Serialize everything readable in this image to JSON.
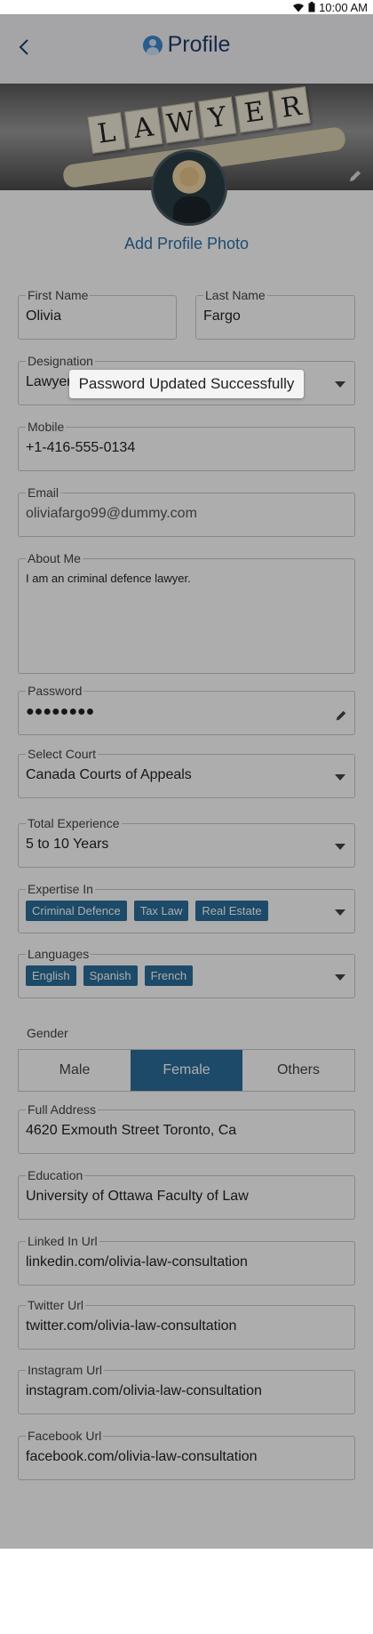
{
  "status": {
    "time": "10:00 AM"
  },
  "header": {
    "title": "Profile"
  },
  "banner": {
    "tiles": [
      "L",
      "A",
      "W",
      "Y",
      "E",
      "R"
    ]
  },
  "profile": {
    "add_photo_label": "Add Profile Photo"
  },
  "form": {
    "first_name": {
      "label": "First Name",
      "value": "Olivia"
    },
    "last_name": {
      "label": "Last Name",
      "value": "Fargo"
    },
    "designation": {
      "label": "Designation",
      "value": "Lawyer"
    },
    "mobile": {
      "label": "Mobile",
      "value": "+1-416-555-0134"
    },
    "email": {
      "label": "Email",
      "value": "oliviafargo99@dummy.com"
    },
    "about": {
      "label": "About Me",
      "value": "I am an criminal defence lawyer."
    },
    "password": {
      "label": "Password",
      "value": "●●●●●●●●"
    },
    "court": {
      "label": "Select Court",
      "value": "Canada Courts of Appeals"
    },
    "experience": {
      "label": "Total Experience",
      "value": "5 to 10 Years"
    },
    "expertise": {
      "label": "Expertise In",
      "chips": [
        "Criminal Defence",
        "Tax Law",
        "Real Estate"
      ]
    },
    "languages": {
      "label": "Languages",
      "chips": [
        "English",
        "Spanish",
        "French"
      ]
    },
    "gender": {
      "label": "Gender",
      "options": [
        "Male",
        "Female",
        "Others"
      ],
      "selected": "Female"
    },
    "address": {
      "label": "Full Address",
      "value": "4620  Exmouth Street Toronto, Ca"
    },
    "education": {
      "label": "Education",
      "value": "University of Ottawa Faculty of Law"
    },
    "linkedin": {
      "label": "Linked In Url",
      "value": "linkedin.com/olivia-law-consultation"
    },
    "twitter": {
      "label": "Twitter Url",
      "value": "twitter.com/olivia-law-consultation"
    },
    "instagram": {
      "label": "Instagram Url",
      "value": "instagram.com/olivia-law-consultation"
    },
    "facebook": {
      "label": "Facebook Url",
      "value": "facebook.com/olivia-law-consultation"
    }
  },
  "toast": {
    "message": "Password Updated Successfully"
  }
}
